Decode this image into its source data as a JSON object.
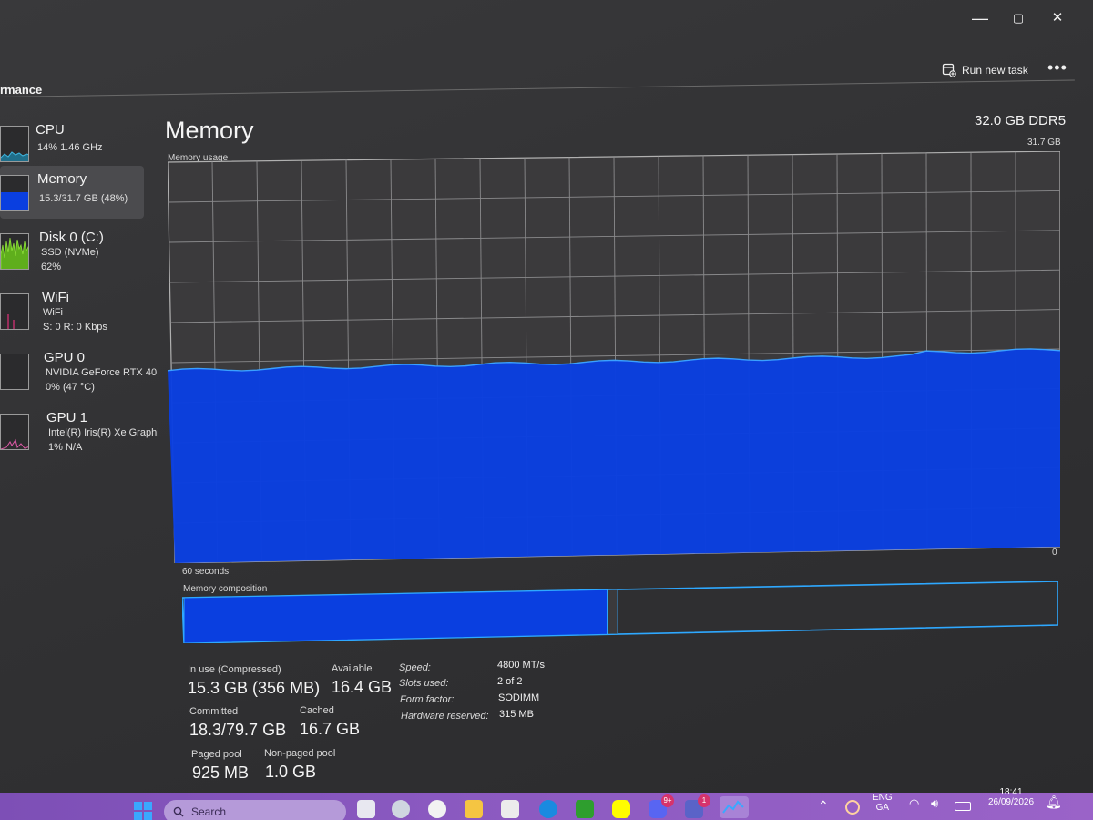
{
  "window": {
    "controls": {
      "minimize": "—",
      "restore": "▢",
      "close": "✕"
    }
  },
  "toolbar": {
    "page_heading": "rmance",
    "run_new_task": "Run new task",
    "more": "•••"
  },
  "sidebar": {
    "items": [
      {
        "name": "CPU",
        "sub1": "14%  1.46 GHz",
        "sub2": ""
      },
      {
        "name": "Memory",
        "sub1": "15.3/31.7 GB (48%)",
        "sub2": ""
      },
      {
        "name": "Disk 0 (C:)",
        "sub1": "SSD (NVMe)",
        "sub2": "62%"
      },
      {
        "name": "WiFi",
        "sub1": "WiFi",
        "sub2": "S: 0  R: 0 Kbps"
      },
      {
        "name": "GPU 0",
        "sub1": "NVIDIA GeForce RTX 40",
        "sub2": "0%  (47 °C)"
      },
      {
        "name": "GPU 1",
        "sub1": "Intel(R) Iris(R) Xe Graphi",
        "sub2": "1%  N/A"
      }
    ]
  },
  "main": {
    "title": "Memory",
    "spec": "32.0 GB DDR5",
    "usage_label": "Memory usage",
    "usage_max": "31.7 GB",
    "zero_label": "0",
    "time_label": "60 seconds",
    "usage_fraction": 0.48,
    "composition_label": "Memory composition",
    "composition": {
      "in_use_fraction": 0.485,
      "modified_fraction": 0.012
    },
    "accent_color": "#0a3fe0",
    "accent_border": "#2ea8ff"
  },
  "stats": {
    "in_use_label": "In use (Compressed)",
    "in_use_value": "15.3 GB (356 MB)",
    "available_label": "Available",
    "available_value": "16.4 GB",
    "committed_label": "Committed",
    "committed_value": "18.3/79.7 GB",
    "cached_label": "Cached",
    "cached_value": "16.7 GB",
    "paged_pool_label": "Paged pool",
    "paged_pool_value": "925 MB",
    "nonpaged_pool_label": "Non-paged pool",
    "nonpaged_pool_value": "1.0 GB"
  },
  "specs": {
    "speed_label": "Speed:",
    "speed_value": "4800 MT/s",
    "slots_label": "Slots used:",
    "slots_value": "2 of 2",
    "form_label": "Form factor:",
    "form_value": "SODIMM",
    "reserved_label": "Hardware reserved:",
    "reserved_value": "315 MB"
  },
  "taskbar": {
    "search_placeholder": "Search",
    "badge_discord": "9+",
    "badge_teams": "1",
    "lang_top": "ENG",
    "lang_bottom": "GA",
    "time": "18:41",
    "date": "26/09/2026"
  }
}
